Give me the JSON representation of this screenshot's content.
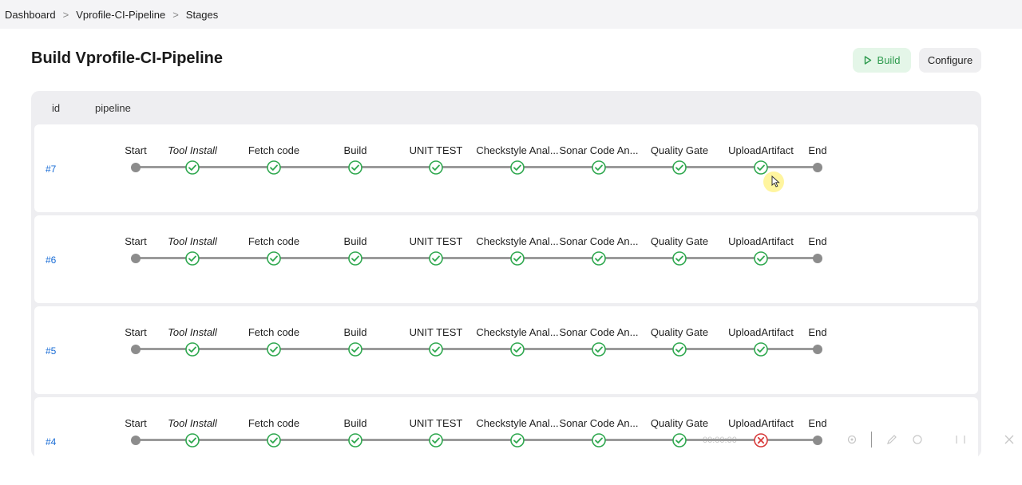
{
  "breadcrumb": {
    "items": [
      "Dashboard",
      "Vprofile-CI-Pipeline",
      "Stages"
    ],
    "separator": ">"
  },
  "page": {
    "title": "Build Vprofile-CI-Pipeline",
    "build_label": "Build",
    "configure_label": "Configure"
  },
  "table": {
    "columns": [
      "id",
      "pipeline"
    ]
  },
  "stages": [
    {
      "label": "Start",
      "kind": "dot"
    },
    {
      "label": "Tool Install",
      "kind": "status",
      "italic": true
    },
    {
      "label": "Fetch code",
      "kind": "status"
    },
    {
      "label": "Build",
      "kind": "status"
    },
    {
      "label": "UNIT TEST",
      "kind": "status"
    },
    {
      "label": "Checkstyle Anal...",
      "kind": "status"
    },
    {
      "label": "Sonar Code An...",
      "kind": "status"
    },
    {
      "label": "Quality Gate",
      "kind": "status"
    },
    {
      "label": "UploadArtifact",
      "kind": "status"
    },
    {
      "label": "End",
      "kind": "dot"
    }
  ],
  "runs": [
    {
      "id": "#7",
      "statuses": [
        "success",
        "success",
        "success",
        "success",
        "success",
        "success",
        "success",
        "success"
      ]
    },
    {
      "id": "#6",
      "statuses": [
        "success",
        "success",
        "success",
        "success",
        "success",
        "success",
        "success",
        "success"
      ]
    },
    {
      "id": "#5",
      "statuses": [
        "success",
        "success",
        "success",
        "success",
        "success",
        "success",
        "success",
        "success"
      ]
    },
    {
      "id": "#4",
      "statuses": [
        "success",
        "success",
        "success",
        "success",
        "success",
        "success",
        "success",
        "failed"
      ]
    }
  ],
  "colors": {
    "success": "#2fa84f",
    "failed": "#d83a3a",
    "link": "#1a6dd6",
    "build_bg": "#e4f6e8"
  },
  "player": {
    "time": "00:00:00"
  }
}
